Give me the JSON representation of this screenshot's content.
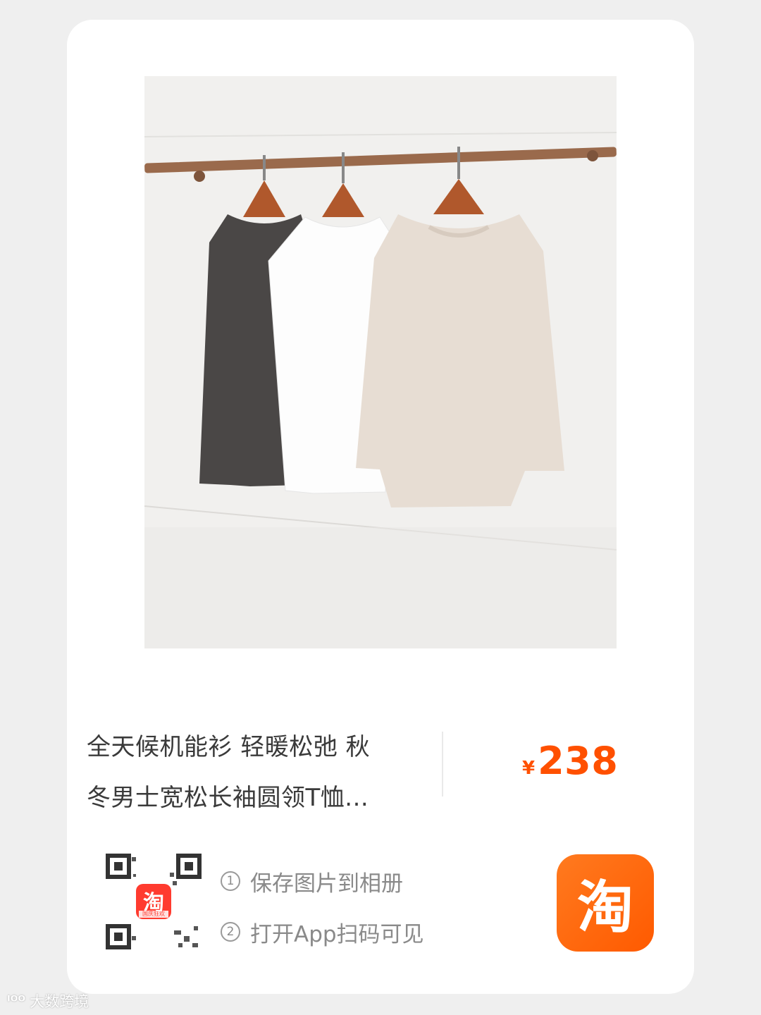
{
  "product": {
    "title_line1": "全天候机能衫 轻暖松弛 秋",
    "title_line2": "冬男士宽松长袖圆领T恤...",
    "currency": "¥",
    "price": "238"
  },
  "share": {
    "steps": [
      {
        "num": "1",
        "text": "保存图片到相册"
      },
      {
        "num": "2",
        "text": "打开App扫码可见"
      }
    ],
    "qr_center_badge": "淘",
    "qr_center_caption": "国庆狂欢",
    "app_icon_glyph": "淘"
  },
  "watermark": {
    "logo": "ᴵᴼᴼ",
    "text": "大数跨境"
  },
  "colors": {
    "accent": "#ff5000",
    "app_icon": "#ff6a00",
    "card": "#ffffff",
    "background": "#efefef"
  },
  "icons": [
    "qr-code-icon",
    "taobao-app-icon",
    "circled-number-icon"
  ]
}
